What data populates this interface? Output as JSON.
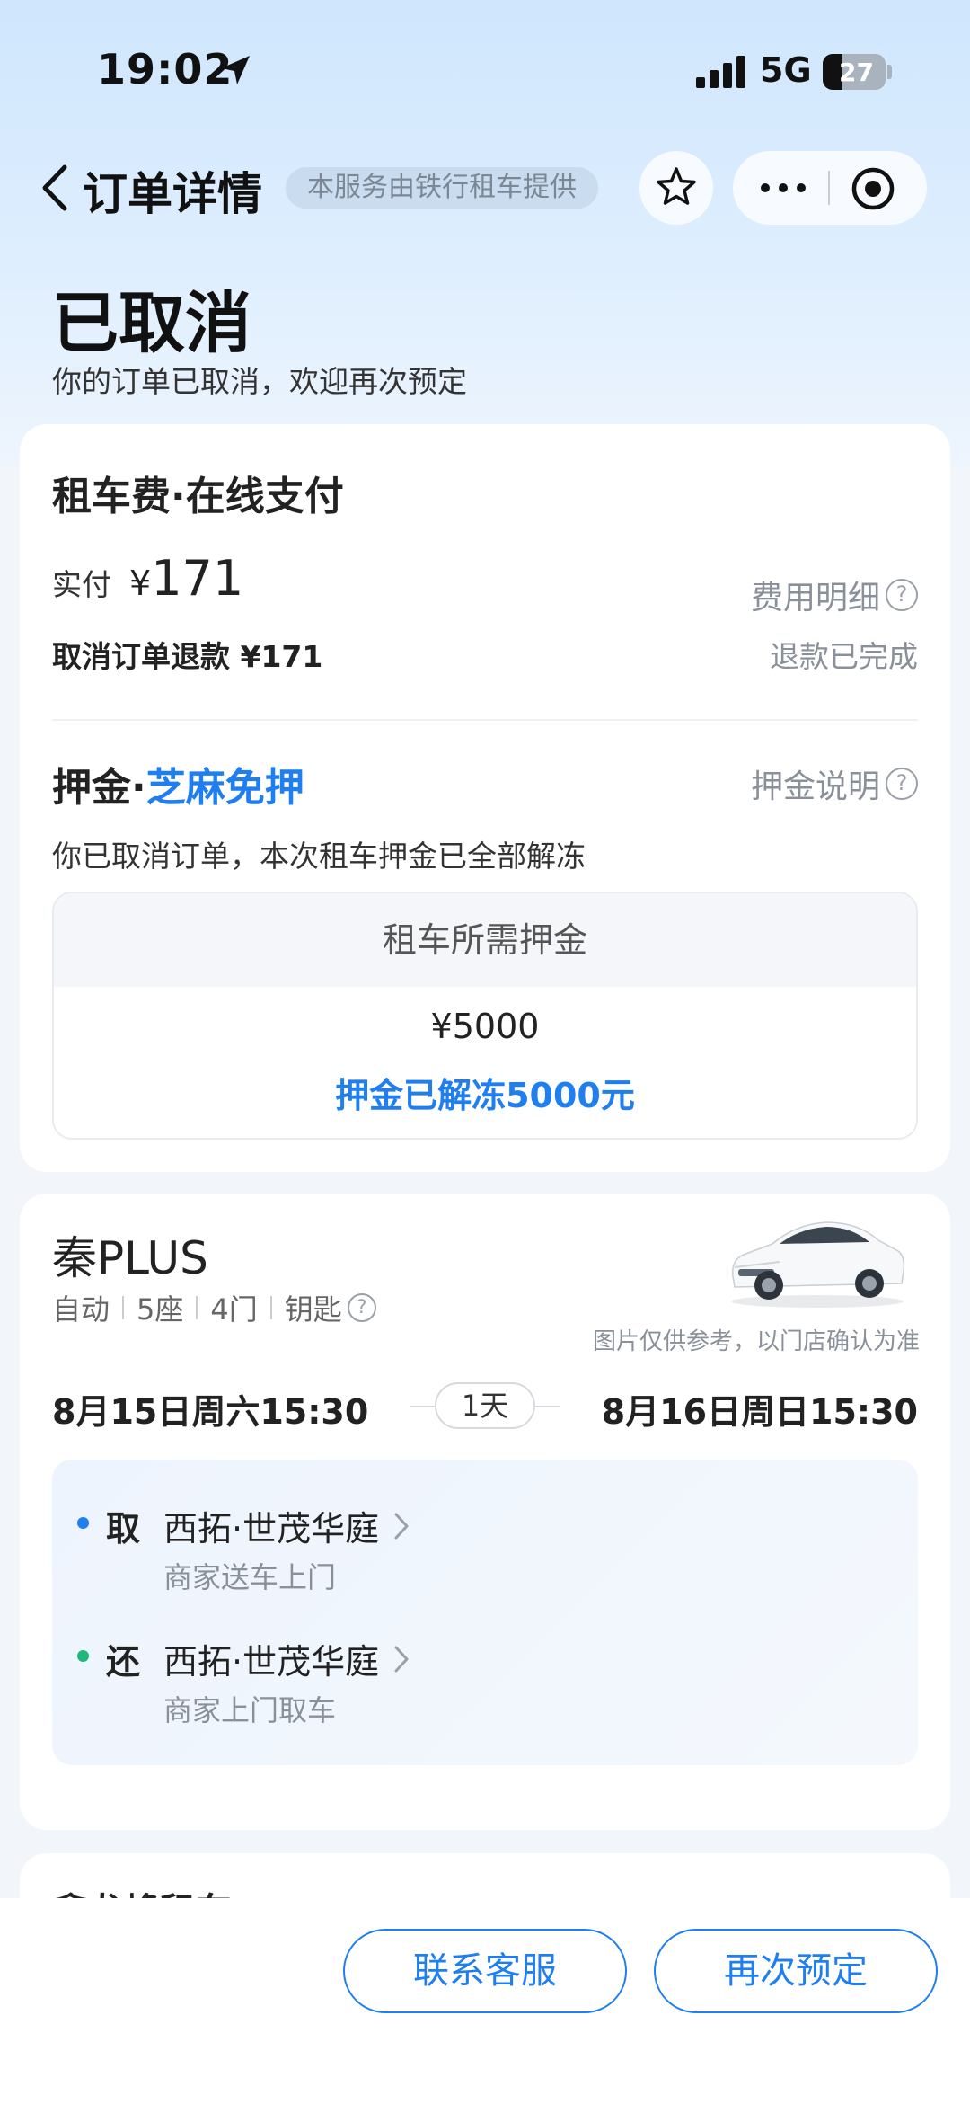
{
  "status_bar": {
    "time": "19:02",
    "network": "5G",
    "battery": "27"
  },
  "nav": {
    "title": "订单详情",
    "provider": "本服务由铁行租车提供"
  },
  "header": {
    "status": "已取消",
    "subtitle": "你的订单已取消，欢迎再次预定"
  },
  "payment": {
    "title": "租车费·在线支付",
    "paid_label": "实付",
    "paid_currency": "¥",
    "paid_amount": "171",
    "fee_detail_link": "费用明细",
    "refund_label": "取消订单退款 ¥171",
    "refund_status": "退款已完成"
  },
  "deposit": {
    "title_prefix": "押金·",
    "title_highlight": "芝麻免押",
    "info_link": "押金说明",
    "note": "你已取消订单，本次租车押金已全部解冻",
    "box_header": "租车所需押金",
    "amount": "¥5000",
    "unfrozen_text": "押金已解冻5000元"
  },
  "car": {
    "name": "秦PLUS",
    "specs": [
      "自动",
      "5座",
      "4门",
      "钥匙"
    ],
    "image_note": "图片仅供参考，以门店确认为准",
    "pickup_datetime": "8月15日周六15:30",
    "return_datetime": "8月16日周日15:30",
    "duration": "1天",
    "pickup": {
      "kind": "取",
      "location": "西拓·世茂华庭",
      "note": "商家送车上门",
      "dot_color": "#1f7ef0"
    },
    "return": {
      "kind": "还",
      "location": "西拓·世茂华庭",
      "note": "商家上门取车",
      "dot_color": "#1fb87a"
    }
  },
  "store": {
    "name_partial": "鑫龙峰租车"
  },
  "actions": {
    "contact_service": "联系客服",
    "rebook": "再次预定"
  }
}
